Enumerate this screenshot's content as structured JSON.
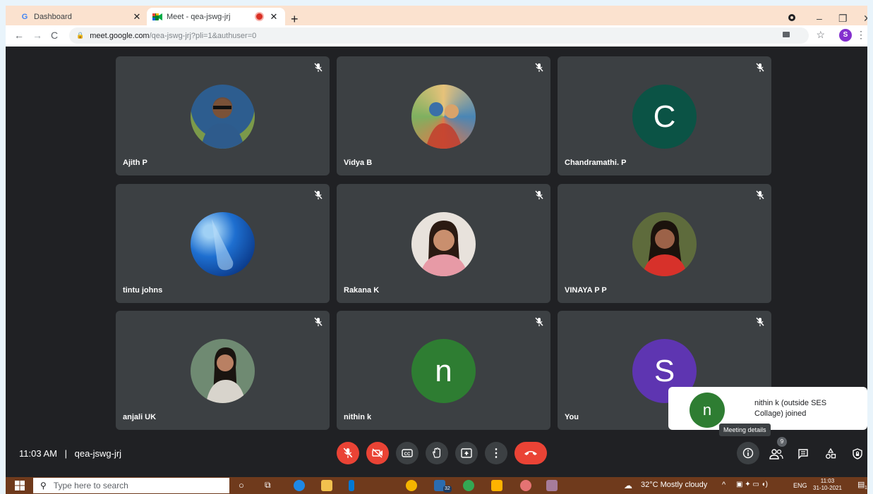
{
  "browser": {
    "tabs": [
      {
        "label": "Dashboard",
        "favicon": "google-g-icon"
      },
      {
        "label": "Meet - qea-jswg-jrj",
        "favicon": "meet-icon",
        "recording": true
      }
    ],
    "url_host": "meet.google.com",
    "url_path": "/qea-jswg-jrj?pli=1&authuser=0",
    "profile_initial": "S"
  },
  "participants": [
    {
      "name": "Ajith P",
      "avatar_type": "photo",
      "avatar_color": "#5a7a3a"
    },
    {
      "name": "Vidya B",
      "avatar_type": "photo",
      "avatar_color": "#c9a06a"
    },
    {
      "name": "Chandramathi. P",
      "avatar_type": "letter",
      "letter": "C",
      "avatar_color": "#0b5345"
    },
    {
      "name": "tintu johns",
      "avatar_type": "photo",
      "avatar_color": "#1565c0"
    },
    {
      "name": "Rakana K",
      "avatar_type": "photo",
      "avatar_color": "#d9a5a0"
    },
    {
      "name": "VINAYA P P",
      "avatar_type": "photo",
      "avatar_color": "#c0392b"
    },
    {
      "name": "anjali UK",
      "avatar_type": "photo",
      "avatar_color": "#4e6b5a"
    },
    {
      "name": "nithin k",
      "avatar_type": "letter",
      "letter": "n",
      "avatar_color": "#2e7d32"
    },
    {
      "name": "You",
      "avatar_type": "letter",
      "letter": "S",
      "avatar_color": "#5e35b1"
    }
  ],
  "meeting": {
    "time": "11:03 AM",
    "separator": "|",
    "code": "qea-jswg-jrj",
    "participant_count": "9"
  },
  "toast": {
    "letter": "n",
    "text": "nithin k (outside SES Collage) joined"
  },
  "tooltip": "Meeting details",
  "taskbar": {
    "search_placeholder": "Type here to search",
    "weather": "32°C  Mostly cloudy",
    "language": "ENG",
    "time": "11:03",
    "date": "31-10-2021",
    "notification_count": "14",
    "app_badge": "32"
  },
  "colors": {
    "meet_bg": "#202124",
    "tile_bg": "#3c4043",
    "danger": "#ea4335",
    "taskbar": "#6f3a1c"
  }
}
